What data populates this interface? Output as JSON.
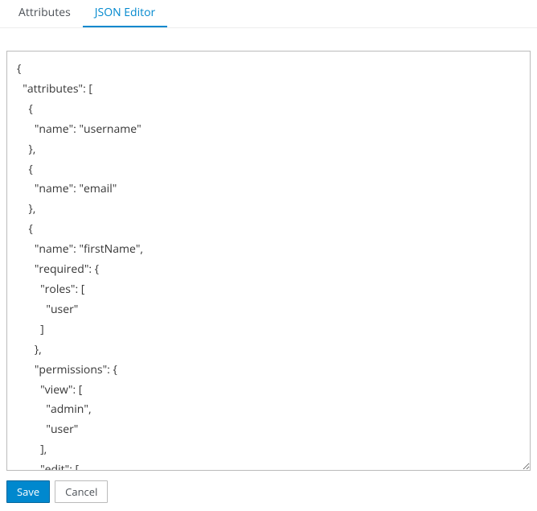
{
  "tabs": {
    "attributes": "Attributes",
    "json_editor": "JSON Editor"
  },
  "editor": {
    "content": "{\n  \"attributes\": [\n    {\n      \"name\": \"username\"\n    },\n    {\n      \"name\": \"email\"\n    },\n    {\n      \"name\": \"firstName\",\n      \"required\": {\n        \"roles\": [\n          \"user\"\n        ]\n      },\n      \"permissions\": {\n        \"view\": [\n          \"admin\",\n          \"user\"\n        ],\n        \"edit\": [\n"
  },
  "buttons": {
    "save": "Save",
    "cancel": "Cancel"
  }
}
